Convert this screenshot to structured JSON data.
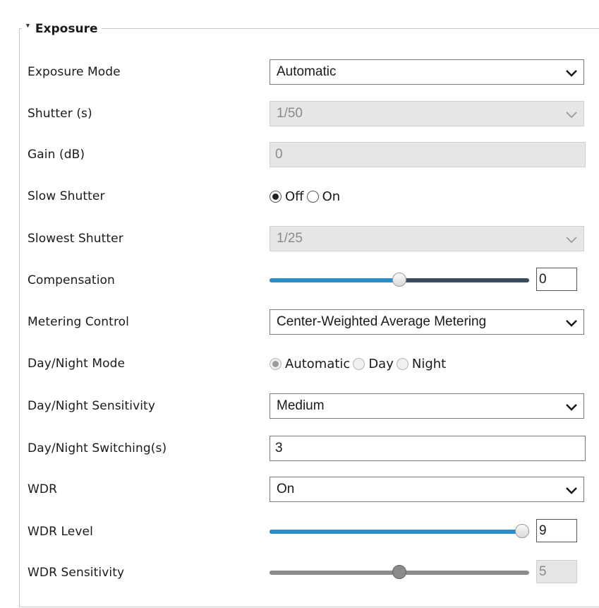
{
  "section": {
    "title": "Exposure",
    "collapse_icon": "caret-down-icon"
  },
  "exposure_mode": {
    "label": "Exposure Mode",
    "value": "Automatic"
  },
  "shutter": {
    "label": "Shutter (s)",
    "value": "1/50"
  },
  "gain": {
    "label": "Gain (dB)",
    "value": "0"
  },
  "slow_shutter": {
    "label": "Slow Shutter",
    "options": [
      "Off",
      "On"
    ],
    "selected": "Off"
  },
  "slowest_shutter": {
    "label": "Slowest Shutter",
    "value": "1/25"
  },
  "compensation": {
    "label": "Compensation",
    "value": "0",
    "level": 0.5
  },
  "metering": {
    "label": "Metering Control",
    "value": "Center-Weighted Average Metering"
  },
  "day_night_mode": {
    "label": "Day/Night Mode",
    "options": [
      "Automatic",
      "Day",
      "Night"
    ],
    "selected": "Automatic"
  },
  "day_night_sensitivity": {
    "label": "Day/Night Sensitivity",
    "value": "Medium"
  },
  "day_night_switching": {
    "label": "Day/Night Switching(s)",
    "value": "3"
  },
  "wdr": {
    "label": "WDR",
    "value": "On"
  },
  "wdr_level": {
    "label": "WDR Level",
    "value": "9",
    "level": 1.0
  },
  "wdr_sensitivity": {
    "label": "WDR Sensitivity",
    "value": "5",
    "level": 0.5
  },
  "colors": {
    "accent": "#2a8fc9",
    "track": "#3a4a5c",
    "disabled_bg": "#e6e6e6"
  }
}
